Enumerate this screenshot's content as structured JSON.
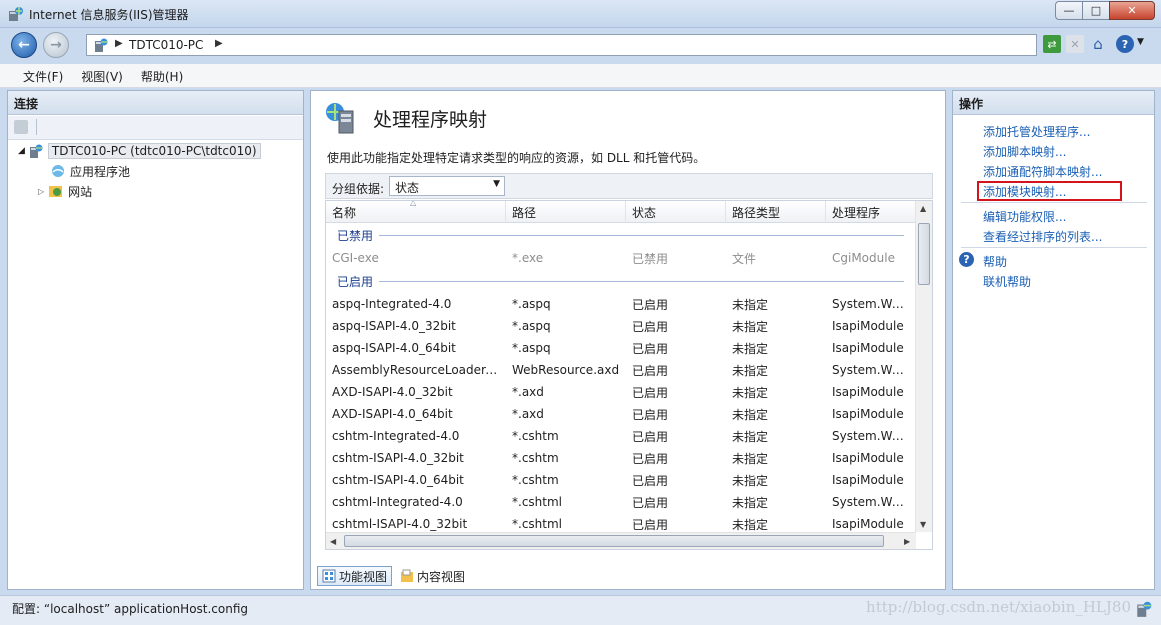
{
  "window": {
    "title": "Internet 信息服务(IIS)管理器",
    "minimize": "—",
    "maximize": "□",
    "close": "✕"
  },
  "address": {
    "path": "TDTC010-PC"
  },
  "menu": {
    "items": [
      "文件(F)",
      "视图(V)",
      "帮助(H)"
    ]
  },
  "connections": {
    "header": "连接",
    "tree": [
      {
        "label": "TDTC010-PC (tdtc010-PC\\tdtc010)",
        "level": 0
      },
      {
        "label": "应用程序池",
        "level": 1
      },
      {
        "label": "网站",
        "level": 1
      }
    ]
  },
  "feature": {
    "title": "处理程序映射",
    "description": "使用此功能指定处理特定请求类型的响应的资源，如 DLL 和托管代码。",
    "group_label": "分组依据:",
    "group_value": "状态",
    "columns": [
      "名称",
      "路径",
      "状态",
      "路径类型",
      "处理程序"
    ],
    "groups": [
      {
        "name": "已禁用",
        "disabled": true,
        "rows": [
          [
            "CGI-exe",
            "*.exe",
            "已禁用",
            "文件",
            "CgiModule"
          ]
        ]
      },
      {
        "name": "已启用",
        "disabled": false,
        "rows": [
          [
            "aspq-Integrated-4.0",
            "*.aspq",
            "已启用",
            "未指定",
            "System.Web.Ht"
          ],
          [
            "aspq-ISAPI-4.0_32bit",
            "*.aspq",
            "已启用",
            "未指定",
            "IsapiModule"
          ],
          [
            "aspq-ISAPI-4.0_64bit",
            "*.aspq",
            "已启用",
            "未指定",
            "IsapiModule"
          ],
          [
            "AssemblyResourceLoader-I...",
            "WebResource.axd",
            "已启用",
            "未指定",
            "System.Web.Ha"
          ],
          [
            "AXD-ISAPI-4.0_32bit",
            "*.axd",
            "已启用",
            "未指定",
            "IsapiModule"
          ],
          [
            "AXD-ISAPI-4.0_64bit",
            "*.axd",
            "已启用",
            "未指定",
            "IsapiModule"
          ],
          [
            "cshtm-Integrated-4.0",
            "*.cshtm",
            "已启用",
            "未指定",
            "System.Web.Ht"
          ],
          [
            "cshtm-ISAPI-4.0_32bit",
            "*.cshtm",
            "已启用",
            "未指定",
            "IsapiModule"
          ],
          [
            "cshtm-ISAPI-4.0_64bit",
            "*.cshtm",
            "已启用",
            "未指定",
            "IsapiModule"
          ],
          [
            "cshtml-Integrated-4.0",
            "*.cshtml",
            "已启用",
            "未指定",
            "System.Web.Ht"
          ],
          [
            "cshtml-ISAPI-4.0_32bit",
            "*.cshtml",
            "已启用",
            "未指定",
            "IsapiModule"
          ]
        ]
      }
    ],
    "views": [
      "功能视图",
      "内容视图"
    ]
  },
  "actions": {
    "header": "操作",
    "links_group1": [
      "添加托管处理程序...",
      "添加脚本映射...",
      "添加通配符脚本映射...",
      "添加模块映射..."
    ],
    "links_group2": [
      "编辑功能权限...",
      "查看经过排序的列表..."
    ],
    "help": [
      "帮助",
      "联机帮助"
    ]
  },
  "status": {
    "text": "配置: “localhost” applicationHost.config",
    "watermark": "http://blog.csdn.net/xiaobin_HLJ80"
  },
  "colors": {
    "link": "#1a5fb4",
    "highlight": "#d4141c",
    "group_header": "#1b3f8f"
  }
}
